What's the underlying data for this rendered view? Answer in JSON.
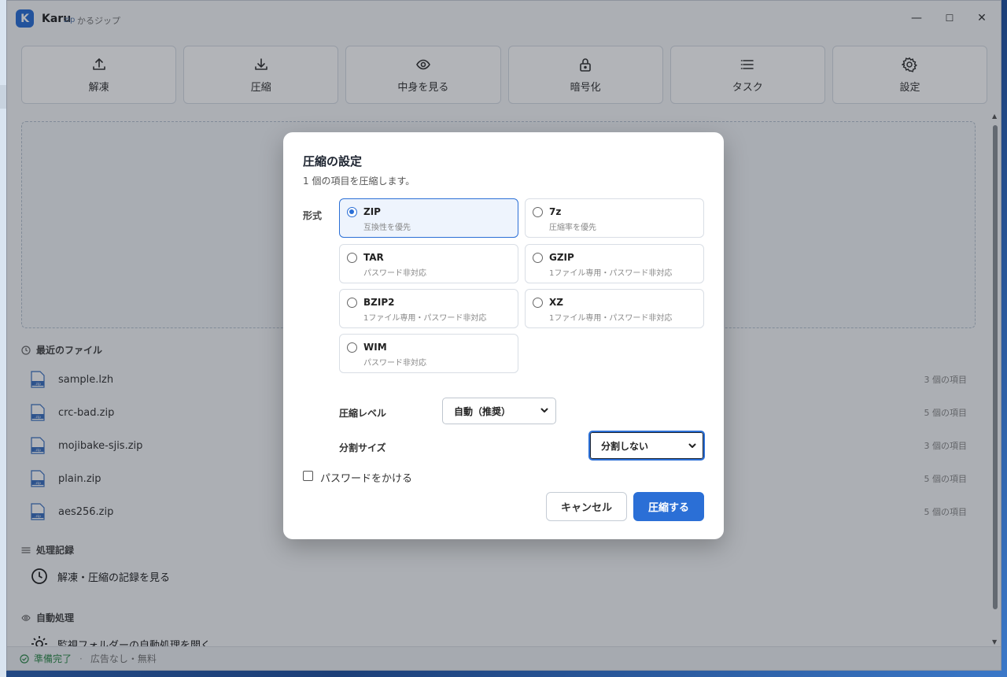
{
  "app": {
    "logo_letter": "K",
    "name": "Karu",
    "name_sub": "zip",
    "name_jp": "かるジップ"
  },
  "window_controls": {
    "minimize": "—",
    "maximize": "☐",
    "close": "✕"
  },
  "toolbar": [
    {
      "label": "解凍",
      "icon": "upload-icon"
    },
    {
      "label": "圧縮",
      "icon": "download-icon"
    },
    {
      "label": "中身を見る",
      "icon": "eye-icon"
    },
    {
      "label": "暗号化",
      "icon": "lock-icon"
    },
    {
      "label": "タスク",
      "icon": "list-icon"
    },
    {
      "label": "設定",
      "icon": "gear-icon"
    }
  ],
  "recent": {
    "heading": "最近のファイル",
    "files": [
      {
        "name": "sample.lzh",
        "count": "3 個の項目"
      },
      {
        "name": "crc-bad.zip",
        "count": "5 個の項目"
      },
      {
        "name": "mojibake-sjis.zip",
        "count": "3 個の項目"
      },
      {
        "name": "plain.zip",
        "count": "5 個の項目"
      },
      {
        "name": "aes256.zip",
        "count": "5 個の項目"
      }
    ],
    "file_icon_tag": ".zip"
  },
  "history": {
    "heading": "処理記録",
    "link": "解凍・圧縮の記録を見る"
  },
  "auto": {
    "heading": "自動処理",
    "link": "監視フォルダーの自動処理を開く"
  },
  "status": {
    "ready": "準備完了",
    "separator": "·",
    "info": "広告なし・無料"
  },
  "dialog": {
    "title": "圧縮の設定",
    "subtitle": "1 個の項目を圧縮します。",
    "format_label": "形式",
    "formats": [
      {
        "name": "ZIP",
        "desc": "互換性を優先",
        "selected": true
      },
      {
        "name": "7z",
        "desc": "圧縮率を優先",
        "selected": false
      },
      {
        "name": "TAR",
        "desc": "パスワード非対応",
        "selected": false
      },
      {
        "name": "GZIP",
        "desc": "1ファイル専用・パスワード非対応",
        "selected": false
      },
      {
        "name": "BZIP2",
        "desc": "1ファイル専用・パスワード非対応",
        "selected": false
      },
      {
        "name": "XZ",
        "desc": "1ファイル専用・パスワード非対応",
        "selected": false
      },
      {
        "name": "WIM",
        "desc": "パスワード非対応",
        "selected": false
      }
    ],
    "level_label": "圧縮レベル",
    "level_value": "自動（推奨）",
    "split_label": "分割サイズ",
    "split_value": "分割しない",
    "password_label": "パスワードをかける",
    "password_checked": false,
    "cancel_label": "キャンセル",
    "ok_label": "圧縮する"
  },
  "colors": {
    "accent": "#2b6fd6",
    "status_ok": "#2f8a4b"
  }
}
